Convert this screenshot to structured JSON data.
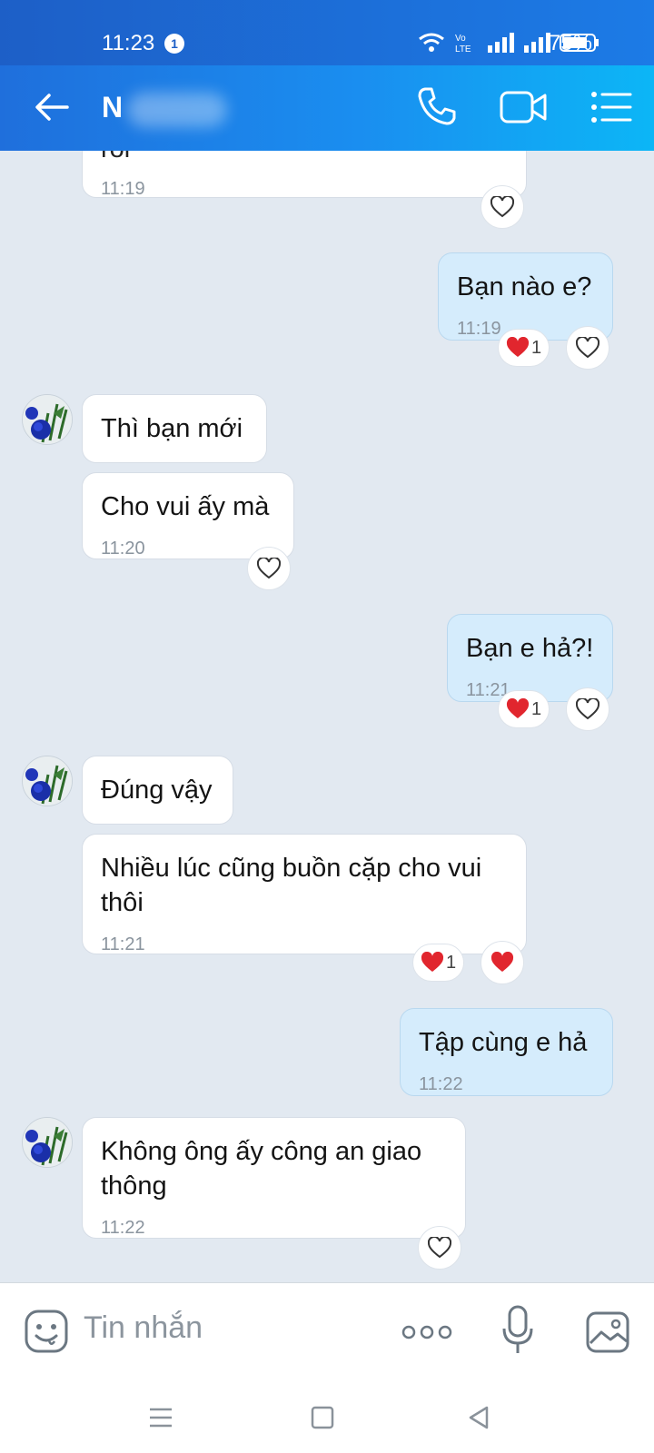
{
  "status_bar": {
    "time": "11:23",
    "notification_count": "1",
    "network_label": "Vo LTE",
    "battery": "75%"
  },
  "header": {
    "contact_name": "N",
    "accent": "#1a8ef0"
  },
  "messages": [
    {
      "from": "them",
      "text": "roi",
      "time": "11:19"
    },
    {
      "from": "me",
      "text": "Bạn nào e?",
      "time": "11:19",
      "reaction_count": "1"
    },
    {
      "from": "them",
      "text": "Thì bạn mới",
      "time": ""
    },
    {
      "from": "them",
      "text": "Cho vui ấy mà",
      "time": "11:20"
    },
    {
      "from": "me",
      "text": "Bạn e hả?!",
      "time": "11:21",
      "reaction_count": "1"
    },
    {
      "from": "them",
      "text": "Đúng vậy",
      "time": ""
    },
    {
      "from": "them",
      "text": "Nhiều lúc cũng buồn cặp cho vui thôi",
      "line1": "Nhiều lúc cũng buồn cặp cho vui",
      "line2": "thôi",
      "time": "11:21",
      "reaction_count": "1"
    },
    {
      "from": "me",
      "text": "Tập cùng e hả",
      "time": "11:22"
    },
    {
      "from": "them",
      "text": "Không ông ấy công an giao thông",
      "line1": "Không ông ấy công an giao",
      "line2": "thông",
      "time": "11:22"
    }
  ],
  "composer": {
    "placeholder": "Tin nhắn"
  }
}
